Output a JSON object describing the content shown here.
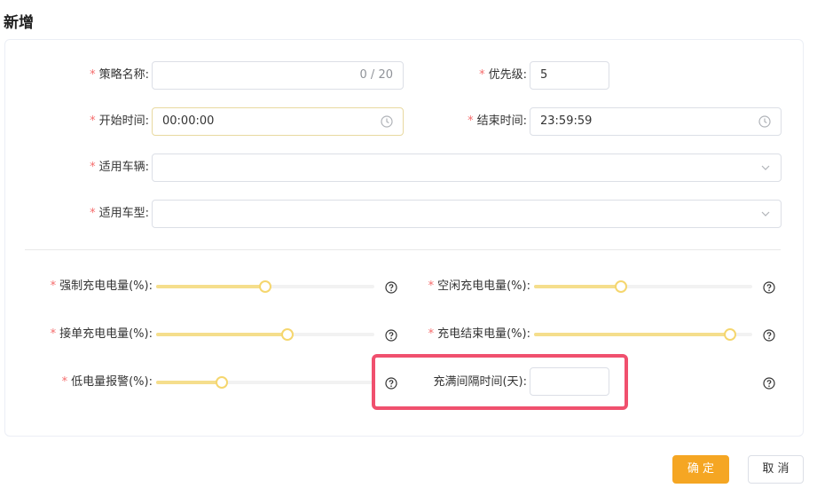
{
  "dialog": {
    "title": "新增"
  },
  "form": {
    "required_mark": "*",
    "strategy_name": {
      "label": "策略名称:",
      "value": "",
      "counter": "0 / 20"
    },
    "priority": {
      "label": "优先级:",
      "value": "5"
    },
    "start_time": {
      "label": "开始时间:",
      "value": "00:00:00",
      "icon": "clock-icon"
    },
    "end_time": {
      "label": "结束时间:",
      "value": "23:59:59",
      "icon": "clock-icon"
    },
    "vehicles": {
      "label": "适用车辆:",
      "value": "",
      "icon": "chevron-down-icon"
    },
    "vehicle_models": {
      "label": "适用车型:",
      "value": "",
      "icon": "chevron-down-icon"
    }
  },
  "sliders": {
    "forced_charge": {
      "label": "强制充电电量(%):",
      "level": 0.5
    },
    "idle_charge": {
      "label": "空闲充电电量(%):",
      "level": 0.4
    },
    "order_charge": {
      "label": "接单充电电量(%):",
      "level": 0.6
    },
    "charge_end": {
      "label": "充电结束电量(%):",
      "level": 0.9
    },
    "low_battery_alarm": {
      "label": "低电量报警(%):",
      "level": 0.3
    }
  },
  "full_charge_interval": {
    "label": "充满间隔时间(天):",
    "value": ""
  },
  "buttons": {
    "confirm": "确 定",
    "cancel": "取 消"
  },
  "colors": {
    "accent": "#f5a623",
    "slider_fill": "#f5de8c",
    "highlight": "#f0506e",
    "required": "#f56c6c"
  }
}
